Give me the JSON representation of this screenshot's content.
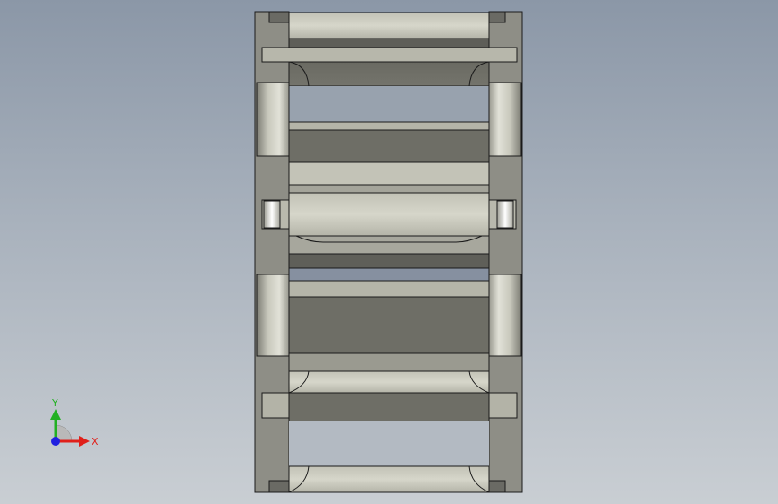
{
  "app": {
    "view": "cad-viewport"
  },
  "colors": {
    "background_top": "#8b97a7",
    "background_bottom": "#c9ced3",
    "frame_dark": "#6e6e68",
    "frame_mid": "#a9a99f",
    "frame_light": "#c9c9bd",
    "edge": "#1a1a1a",
    "x_axis": "#e0201a",
    "y_axis": "#22b022",
    "z_axis": "#2020e0"
  },
  "triad": {
    "x_label": "X",
    "y_label": "Y"
  }
}
